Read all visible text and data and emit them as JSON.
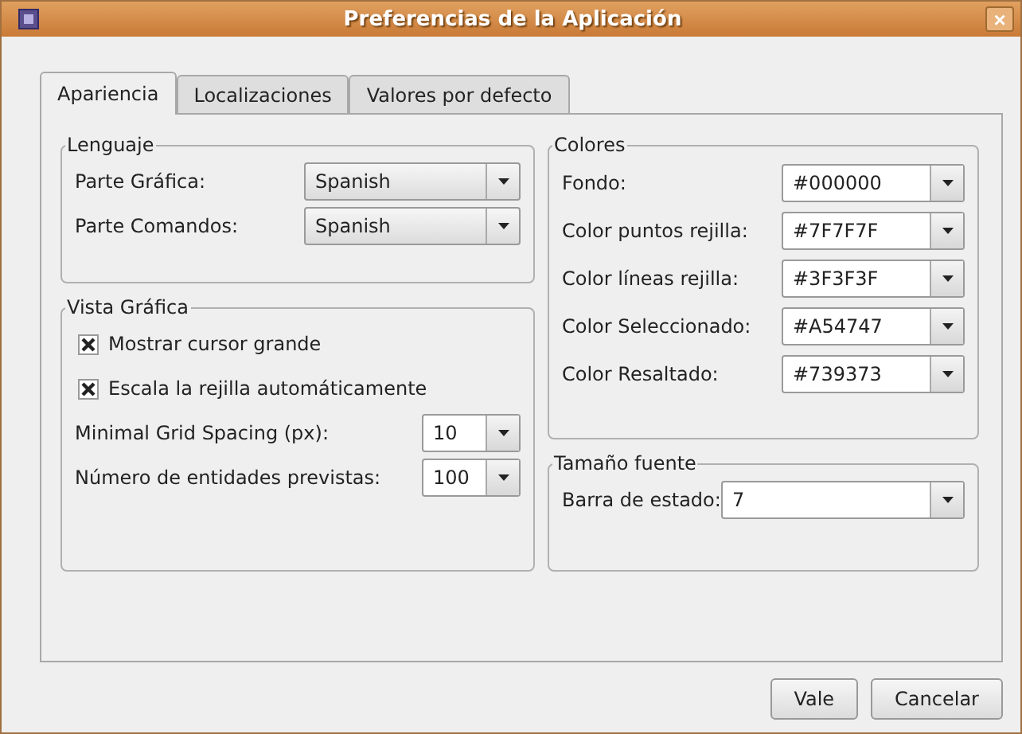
{
  "window": {
    "title": "Preferencias de la Aplicación",
    "close": "×"
  },
  "tabs": [
    {
      "label": "Apariencia",
      "selected": true
    },
    {
      "label": "Localizaciones",
      "selected": false
    },
    {
      "label": "Valores por defecto",
      "selected": false
    }
  ],
  "lenguaje": {
    "title": "Lenguaje",
    "rows": [
      {
        "label": "Parte Gráfica:",
        "kind": "choice",
        "value": "Spanish"
      },
      {
        "label": "Parte Comandos:",
        "kind": "choice",
        "value": "Spanish"
      }
    ]
  },
  "vista_grafica": {
    "title": "Vista Gráfica",
    "checkboxes": [
      {
        "label": "Mostrar cursor grande",
        "checked": true
      },
      {
        "label": "Escala la rejilla automáticamente",
        "checked": true
      }
    ],
    "rows": [
      {
        "label": "Minimal Grid Spacing (px):",
        "kind": "entry",
        "value": "10"
      },
      {
        "label": "Número de entidades previstas:",
        "kind": "entry",
        "value": "100"
      }
    ]
  },
  "colores": {
    "title": "Colores",
    "rows": [
      {
        "label": "Fondo:",
        "kind": "entry",
        "value": "#000000"
      },
      {
        "label": "Color puntos rejilla:",
        "kind": "entry",
        "value": "#7F7F7F"
      },
      {
        "label": "Color líneas rejilla:",
        "kind": "entry",
        "value": "#3F3F3F"
      },
      {
        "label": "Color Seleccionado:",
        "kind": "entry",
        "value": "#A54747"
      },
      {
        "label": "Color Resaltado:",
        "kind": "entry",
        "value": "#739373"
      }
    ]
  },
  "tamano_fuente": {
    "title": "Tamaño fuente",
    "rows": [
      {
        "label": "Barra de estado:",
        "kind": "entry",
        "value": "7"
      }
    ]
  },
  "buttons": [
    "Vale",
    "Cancelar"
  ]
}
